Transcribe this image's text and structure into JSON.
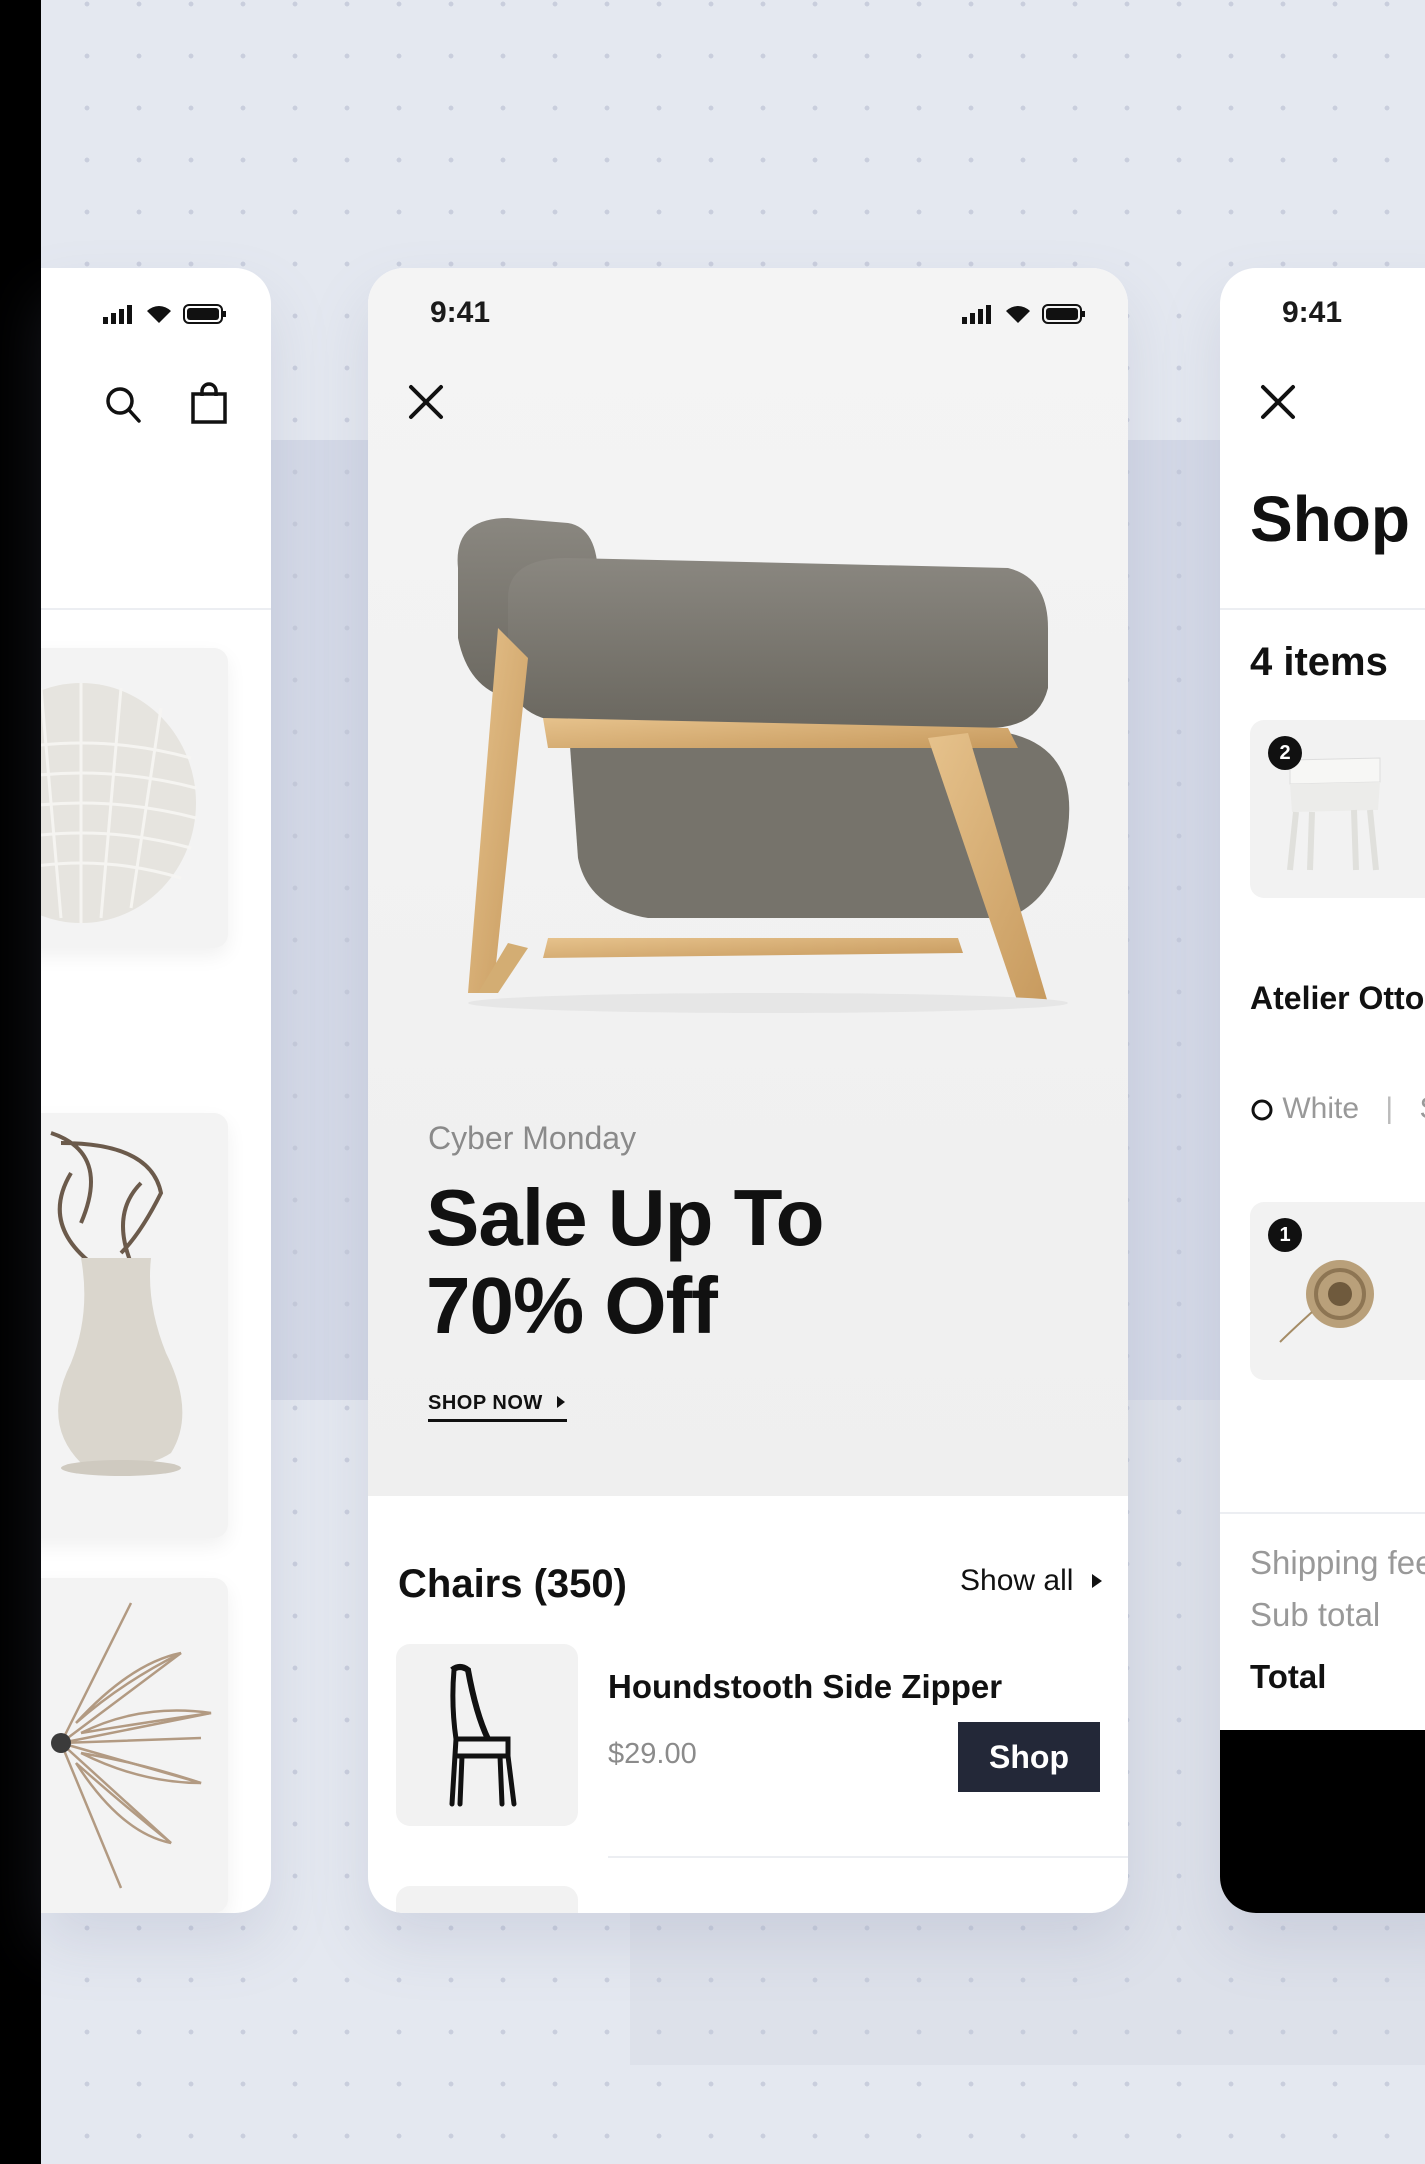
{
  "status_time": "9:41",
  "hero": {
    "eyebrow": "Cyber Monday",
    "headline_line1": "Sale Up To",
    "headline_line2": "70% Off",
    "cta": "SHOP NOW"
  },
  "chairs": {
    "title": "Chairs (350)",
    "show_all": "Show all",
    "product": {
      "name": "Houndstooth Side Zipper",
      "price": "$29.00",
      "button": "Shop"
    }
  },
  "cart": {
    "title": "Shop",
    "count": "4 items",
    "item1": {
      "badge": "2",
      "name": "Atelier Otto",
      "color": "White",
      "separator": "|",
      "size": "S"
    },
    "item2": {
      "badge": "1"
    },
    "shipping_label": "Shipping fee",
    "subtotal_label": "Sub total",
    "total_label": "Total"
  },
  "icons": [
    "signal-icon",
    "wifi-icon",
    "battery-icon",
    "search-icon",
    "bag-icon",
    "close-icon",
    "caret-right-icon"
  ],
  "colors": {
    "shop_button": "#232838",
    "text_dark": "#111111",
    "text_muted": "#8b8b8b",
    "background": "#e4e8f0"
  }
}
